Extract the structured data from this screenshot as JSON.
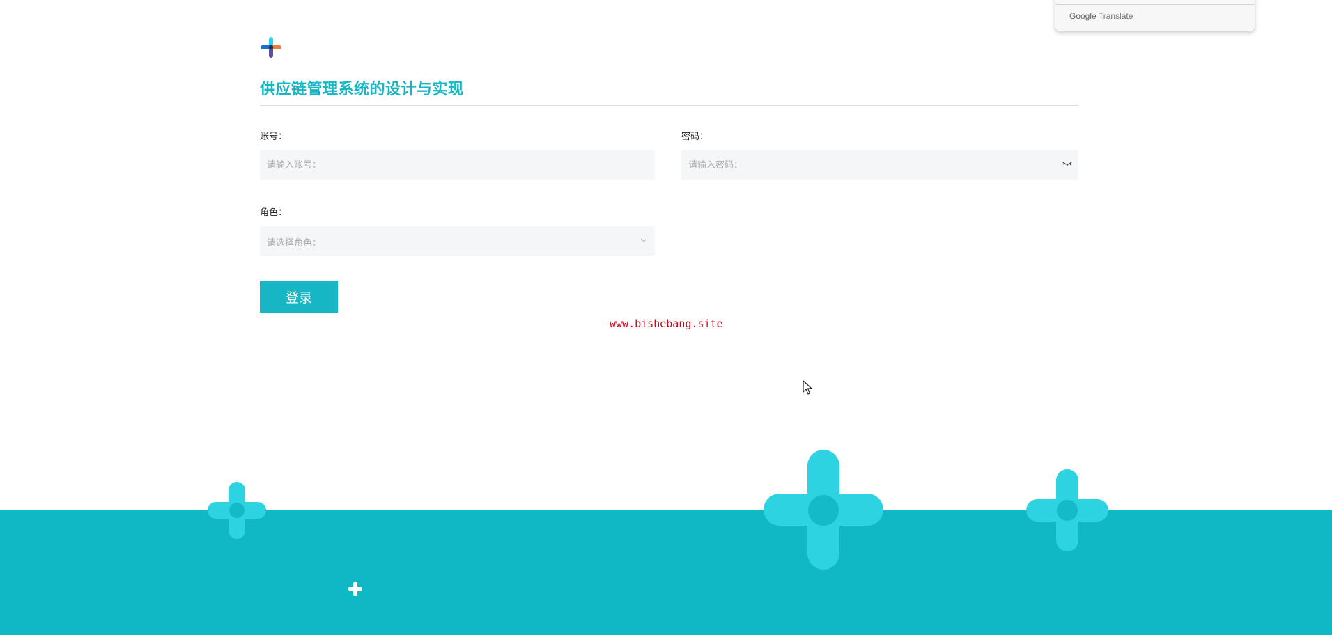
{
  "translate_popup": {
    "brand": "Google",
    "word": "Translate"
  },
  "header": {
    "title": "供应链管理系统的设计与实现"
  },
  "form": {
    "account": {
      "label": "账号：",
      "placeholder": "请输入账号："
    },
    "password": {
      "label": "密码：",
      "placeholder": "请输入密码："
    },
    "role": {
      "label": "角色：",
      "placeholder": "请选择角色："
    },
    "login_label": "登录"
  },
  "watermark_link": "www.bishebang.site",
  "colors": {
    "accent": "#17b6c4",
    "footer": "#10b7c4",
    "decor": "#2dd3e0",
    "link": "#d0021b"
  },
  "icons": {
    "logo": "plus-logo-icon",
    "password_toggle": "eye-closed-icon",
    "select_arrow": "chevron-down-icon"
  }
}
